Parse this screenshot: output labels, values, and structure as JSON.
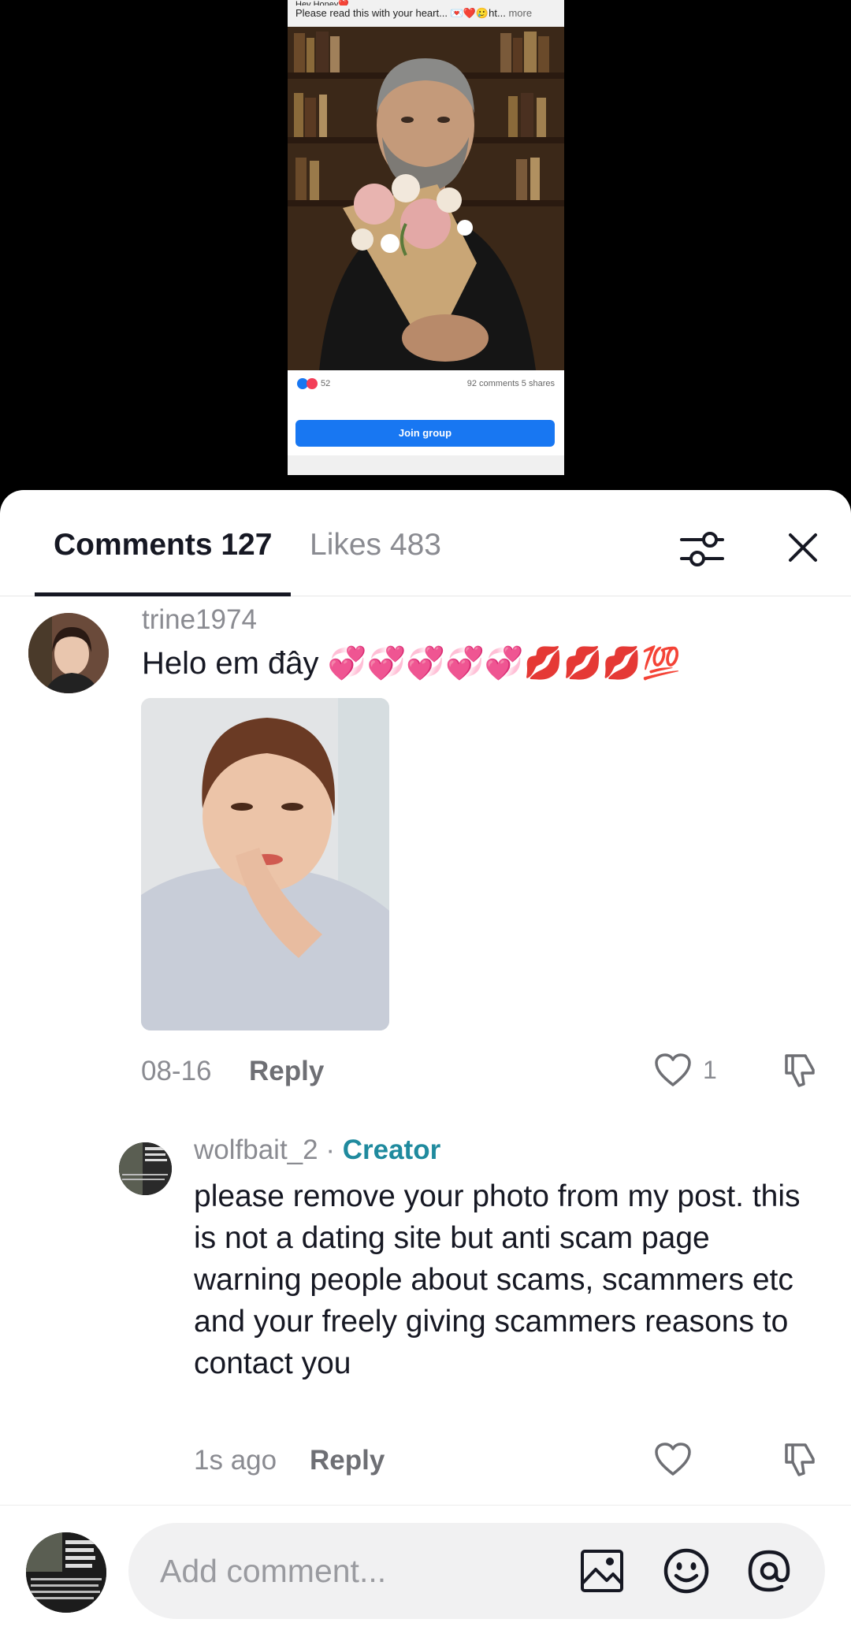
{
  "video_post": {
    "caption_line1": "Hey Honey❤️",
    "caption_line2": "Please read this with your heart...",
    "caption_tail": "💌❤️🥲ht...",
    "caption_more": "more",
    "reaction_count": "52",
    "comments_shares": "92 comments  5 shares",
    "join_button": "Join group"
  },
  "tabs": {
    "comments": "Comments 127",
    "likes": "Likes 483"
  },
  "comments": [
    {
      "username": "trine1974",
      "text": "Helo em đây 💞💞💞💞💞💋💋💋💯",
      "date": "08-16",
      "reply": "Reply",
      "likes": "1"
    },
    {
      "username": "wolfbait_2",
      "separator": " · ",
      "badge": "Creator",
      "text": "please remove your photo from my post. this is not a dating site but anti scam page warning people about scams, scammers etc and your freely giving scammers reasons to contact you",
      "date": "1s ago",
      "reply": "Reply"
    }
  ],
  "input": {
    "placeholder": "Add comment..."
  },
  "colors": {
    "creator_badge": "#1f8a9e",
    "primary_text": "#161823",
    "secondary_text": "#8a8b91",
    "join_button": "#1877f2"
  }
}
